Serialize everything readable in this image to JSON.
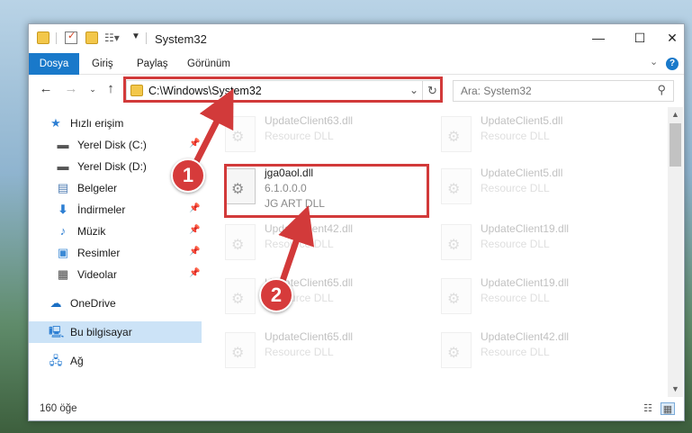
{
  "window": {
    "title": "System32",
    "minimize_icon": "minimize-icon",
    "maximize_icon": "maximize-icon",
    "close_icon": "close-icon"
  },
  "ribbon": {
    "tabs": [
      "Dosya",
      "Giriş",
      "Paylaş",
      "Görünüm"
    ]
  },
  "navigation": {
    "address": "C:\\Windows\\System32",
    "search_placeholder": "Ara: System32"
  },
  "sidebar": {
    "items": [
      {
        "label": "Hızlı erişim",
        "icon": "star-icon"
      },
      {
        "label": "Yerel Disk (C:)",
        "icon": "drive-icon",
        "pinned": true
      },
      {
        "label": "Yerel Disk (D:)",
        "icon": "drive-icon",
        "pinned": false
      },
      {
        "label": "Belgeler",
        "icon": "documents-icon",
        "pinned": true
      },
      {
        "label": "İndirmeler",
        "icon": "download-icon",
        "pinned": true
      },
      {
        "label": "Müzik",
        "icon": "music-icon",
        "pinned": true
      },
      {
        "label": "Resimler",
        "icon": "pictures-icon",
        "pinned": true
      },
      {
        "label": "Videolar",
        "icon": "videos-icon",
        "pinned": true
      },
      {
        "label": "OneDrive",
        "icon": "cloud-icon"
      },
      {
        "label": "Bu bilgisayar",
        "icon": "computer-icon",
        "selected": true
      },
      {
        "label": "Ağ",
        "icon": "network-icon"
      }
    ]
  },
  "files": [
    {
      "name": "UpdateClient63.dll",
      "type": "Resource DLL"
    },
    {
      "name": "UpdateClient5.dll",
      "type": "Resource DLL"
    },
    {
      "name": "jga0aol.dll",
      "version": "6.1.0.0.0",
      "type": "JG ART DLL"
    },
    {
      "name": "UpdateClient5.dll",
      "type": "Resource DLL"
    },
    {
      "name": "UpdateClient42.dll",
      "type": "Resource DLL"
    },
    {
      "name": "UpdateClient19.dll",
      "type": "Resource DLL"
    },
    {
      "name": "UpdateClient65.dll",
      "type": "Resource DLL"
    },
    {
      "name": "UpdateClient19.dll",
      "type": "Resource DLL"
    },
    {
      "name": "UpdateClient65.dll",
      "type": "Resource DLL"
    },
    {
      "name": "UpdateClient42.dll",
      "type": "Resource DLL"
    }
  ],
  "status": {
    "count": "160 öğe"
  },
  "annotations": {
    "step1": "1",
    "step2": "2",
    "color": "#d23a3a"
  }
}
